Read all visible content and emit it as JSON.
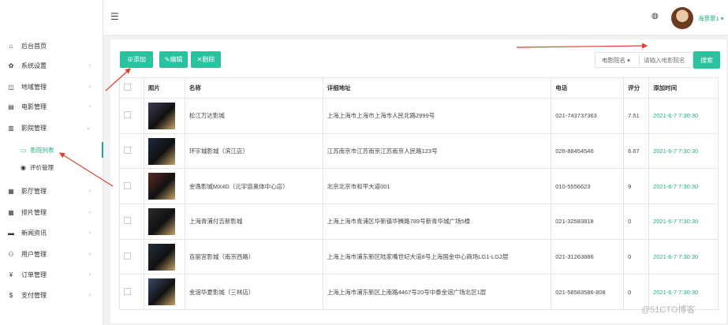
{
  "sidebar": {
    "items": [
      {
        "label": "后台首页",
        "icon": "home-icon",
        "glyph": "⌂",
        "arrow": ""
      },
      {
        "label": "系统设置",
        "icon": "gear-icon",
        "glyph": "✿",
        "arrow": "›"
      },
      {
        "label": "地域管理",
        "icon": "map-icon",
        "glyph": "◫",
        "arrow": "›"
      },
      {
        "label": "电影管理",
        "icon": "film-icon",
        "glyph": "▤",
        "arrow": "›"
      },
      {
        "label": "影院管理",
        "icon": "cinema-icon",
        "glyph": "▥",
        "arrow": "⌄"
      },
      {
        "label": "影厅管理",
        "icon": "hall-icon",
        "glyph": "▦",
        "arrow": "›"
      },
      {
        "label": "排片管理",
        "icon": "schedule-icon",
        "glyph": "▦",
        "arrow": "›"
      },
      {
        "label": "新闻资讯",
        "icon": "news-icon",
        "glyph": "▬",
        "arrow": "›"
      },
      {
        "label": "用户管理",
        "icon": "users-icon",
        "glyph": "⚇",
        "arrow": "›"
      },
      {
        "label": "订单管理",
        "icon": "yen-icon",
        "glyph": "¥",
        "arrow": "›"
      },
      {
        "label": "支付管理",
        "icon": "dollar-icon",
        "glyph": "$",
        "arrow": "›"
      }
    ],
    "sub_items": [
      {
        "label": "影院列表",
        "icon": "list-icon",
        "glyph": "▭"
      },
      {
        "label": "评价管理",
        "icon": "comment-icon",
        "glyph": "◉"
      }
    ]
  },
  "header": {
    "menu_glyph": "☰",
    "palette_glyph": "◍",
    "username": "海景景1 ▾"
  },
  "toolbar": {
    "add_label": "⊕添加",
    "edit_label": "✎编辑",
    "delete_label": "✕删除",
    "select_value": "电影院名 ▾",
    "search_placeholder": "请输入电影院名",
    "search_label": "搜索"
  },
  "table": {
    "headers": [
      "",
      "照片",
      "名称",
      "详细地址",
      "电话",
      "评分",
      "添加时间"
    ],
    "rows": [
      {
        "name": "松江万达影城",
        "address": "上海上海市上海市上海市人民北路2999号",
        "phone": "021-743737363",
        "score": "7.51",
        "time": "2021-6-7 7:30:30",
        "thumb": "#3d3a4f"
      },
      {
        "name": "环宇城影城（滨江店）",
        "address": "江苏南京市江苏南京江苏南京人民路123号",
        "phone": "026-88454546",
        "score": "6.67",
        "time": "2021-6-7 7:30:30",
        "thumb": "#1b2a3a"
      },
      {
        "name": "金逸影城MX4D（元宇宙奥体中心店）",
        "address": "北京北京市和平大道001",
        "phone": "010-5556623",
        "score": "9",
        "time": "2021-6-7 7:30:30",
        "thumb": "#5a2a22"
      },
      {
        "name": "上海青浦付吉新影城",
        "address": "上海上海市青浦区华新镇华腾路789号新青华城广场5楼",
        "phone": "021-32583818",
        "score": "0",
        "time": "2021-6-7 7:30:30",
        "thumb": "#2b2b2b"
      },
      {
        "name": "百丽宫影城（南京西路）",
        "address": "上海上海市浦东新区陆家嘴世纪大道8号上海国金中心商场LG1-LG2层",
        "phone": "021-31263886",
        "score": "0",
        "time": "2021-6-7 7:30:30",
        "thumb": "#23303a"
      },
      {
        "name": "金谊华夏影城（三林店）",
        "address": "上海上海市浦东新区上南路4467号20号中泰金谊广场北区1层",
        "phone": "021-58583586-808",
        "score": "0",
        "time": "2021-6-7 7:30:30",
        "thumb": "#3a4a6a"
      }
    ]
  },
  "watermark": "@51CTO博客",
  "colors": {
    "accent": "#2bc2a0",
    "accent_text": "#1fab89",
    "arrow": "#e0412f"
  }
}
